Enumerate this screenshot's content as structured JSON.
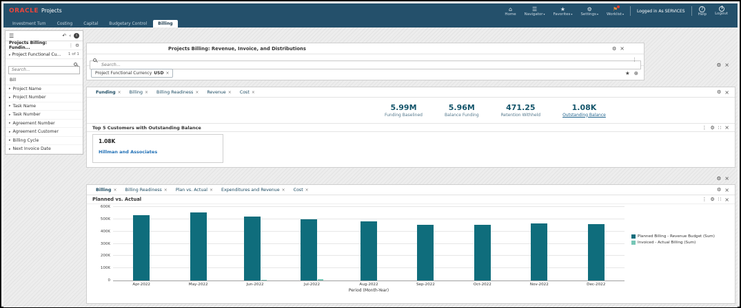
{
  "topbar": {
    "brand": "ORACLE",
    "app": "Projects",
    "items": [
      {
        "id": "home",
        "glyph": "⌂",
        "label": "Home",
        "chevron": false,
        "badge": false
      },
      {
        "id": "navigator",
        "glyph": "☰",
        "label": "Navigator",
        "chevron": true,
        "badge": false
      },
      {
        "id": "favorites",
        "glyph": "★",
        "label": "Favorites",
        "chevron": true,
        "badge": false
      },
      {
        "id": "settings",
        "glyph": "⚙",
        "label": "Settings",
        "chevron": true,
        "badge": false
      },
      {
        "id": "worklist",
        "glyph": "⚑",
        "label": "Worklist",
        "chevron": true,
        "badge": true
      }
    ],
    "user": "Logged in As SERVICES",
    "help": "Help",
    "logout": "Logout"
  },
  "pagetabs": {
    "items": [
      "Investment Turn",
      "Costing",
      "Capital",
      "Budgetary Control",
      "Billing"
    ],
    "active_index": 4
  },
  "sidebar": {
    "title": "Projects Billing: Fundin...",
    "section": "Project Functional Cu...",
    "section_count": "1 of 1",
    "search_placeholder": "Search...",
    "value": "Bill",
    "filters": [
      "Project Name",
      "Project Number",
      "Task Name",
      "Task Number",
      "Agreement Number",
      "Agreement Customer",
      "Billing Cycle",
      "Next Invoice Date"
    ]
  },
  "main": {
    "panel_title": "Projects Billing: Revenue, Invoice, and Distributions",
    "search_placeholder": "Search...",
    "chip": {
      "label": "Project Functional Currency",
      "value": "USD"
    },
    "tabs1": [
      "Funding",
      "Billing",
      "Billing Readiness",
      "Revenue",
      "Cost"
    ],
    "tabs1_active": 0,
    "kpis": [
      {
        "value": "5.99M",
        "label": "Funding Baselined",
        "link": false
      },
      {
        "value": "5.96M",
        "label": "Balance Funding",
        "link": false
      },
      {
        "value": "471.25",
        "label": "Retention Withheld",
        "link": false
      },
      {
        "value": "1.08K",
        "label": "Outstanding Balance",
        "link": true
      }
    ],
    "top5": {
      "title": "Top 5 Customers with Outstanding Balance",
      "value": "1.08K",
      "customer": "Hillman and Associates"
    },
    "tabs2": [
      "Billing",
      "Billing Readiness",
      "Plan vs. Actual",
      "Expenditures and Revenue",
      "Cost"
    ],
    "tabs2_active": 0
  },
  "chart_data": {
    "type": "bar",
    "title": "Planned vs. Actual",
    "categories": [
      "Apr-2022",
      "May-2022",
      "Jun-2022",
      "Jul-2022",
      "Aug-2022",
      "Sep-2022",
      "Oct-2022",
      "Nov-2022",
      "Dec-2022"
    ],
    "series": [
      {
        "name": "Planned Billing - Revenue Budget (Sum)",
        "color": "#0f6d7c",
        "values": [
          530000,
          555000,
          520000,
          500000,
          480000,
          455000,
          455000,
          465000,
          460000
        ]
      },
      {
        "name": "Invoiced - Actual Billing (Sum)",
        "color": "#77c6b6",
        "values": [
          0,
          0,
          5000,
          13000,
          0,
          0,
          0,
          0,
          0
        ]
      }
    ],
    "xlabel": "Period (Month-Year)",
    "ylabel": "",
    "ylim": [
      0,
      600000
    ],
    "yticks": [
      "0",
      "100K",
      "200K",
      "300K",
      "400K",
      "500K",
      "600K"
    ],
    "grid": true,
    "legend_position": "right"
  }
}
